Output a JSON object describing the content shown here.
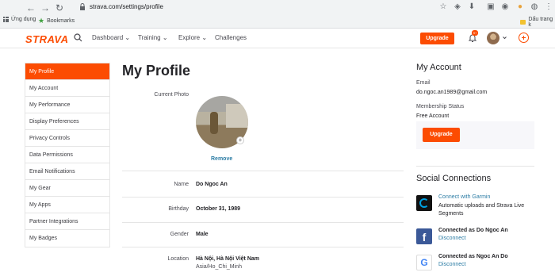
{
  "browser": {
    "url": "strava.com/settings/profile",
    "bookmarks": {
      "apps_label": "Ứng dụng",
      "bookmarks_label": "Bookmarks",
      "other_label": "Dấu trang k"
    }
  },
  "header": {
    "logo": "STRAVA",
    "menu": [
      "Dashboard",
      "Training",
      "Explore",
      "Challenges"
    ],
    "upgrade_label": "Upgrade",
    "notification_count": "9+"
  },
  "sidebar": {
    "items": [
      {
        "label": "My Profile",
        "active": true
      },
      {
        "label": "My Account",
        "active": false
      },
      {
        "label": "My Performance",
        "active": false
      },
      {
        "label": "Display Preferences",
        "active": false
      },
      {
        "label": "Privacy Controls",
        "active": false
      },
      {
        "label": "Data Permissions",
        "active": false
      },
      {
        "label": "Email Notifications",
        "active": false
      },
      {
        "label": "My Gear",
        "active": false
      },
      {
        "label": "My Apps",
        "active": false
      },
      {
        "label": "Partner Integrations",
        "active": false
      },
      {
        "label": "My Badges",
        "active": false
      }
    ]
  },
  "profile": {
    "title": "My Profile",
    "current_photo_label": "Current Photo",
    "remove_label": "Remove",
    "name_label": "Name",
    "name_value": "Do Ngoc An",
    "birthday_label": "Birthday",
    "birthday_value": "October 31, 1989",
    "gender_label": "Gender",
    "gender_value": "Male",
    "location_label": "Location",
    "location_value": "Hà Nội, Hà Nội Việt Nam",
    "timezone_value": "Asia/Ho_Chi_Minh"
  },
  "account": {
    "title": "My Account",
    "email_label": "Email",
    "email_value": "do.ngoc.an1989@gmail.com",
    "membership_label": "Membership Status",
    "membership_value": "Free Account",
    "upgrade_label": "Upgrade"
  },
  "social": {
    "title": "Social Connections",
    "garmin_link": "Connect with Garmin",
    "garmin_desc_1": "Automatic uploads and Strava Live",
    "garmin_desc_2": "Segments",
    "facebook_connected": "Connected as Do Ngoc An",
    "facebook_disconnect": "Disconnect",
    "google_connected": "Connected as Ngoc An Do",
    "google_disconnect": "Disconnect"
  },
  "colors": {
    "brand": "#fc4c02",
    "link": "#2d7da5"
  }
}
